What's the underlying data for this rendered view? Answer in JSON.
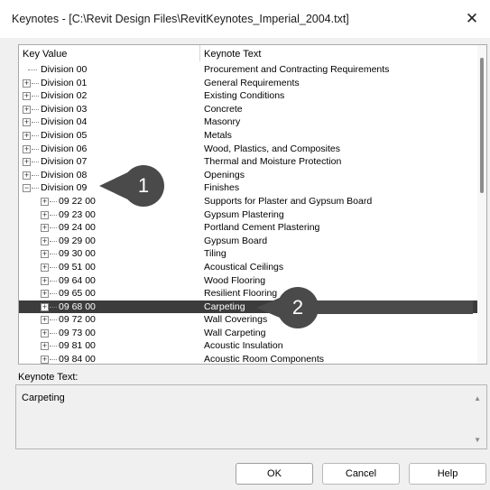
{
  "window": {
    "title": "Keynotes - [C:\\Revit Design Files\\RevitKeynotes_Imperial_2004.txt]"
  },
  "tree": {
    "columns": {
      "key": "Key Value",
      "text": "Keynote Text"
    },
    "rows": [
      {
        "key": "Division 00",
        "text": "Procurement and Contracting Requirements",
        "level": 0,
        "expander": "none"
      },
      {
        "key": "Division 01",
        "text": "General Requirements",
        "level": 0,
        "expander": "+"
      },
      {
        "key": "Division 02",
        "text": "Existing Conditions",
        "level": 0,
        "expander": "+"
      },
      {
        "key": "Division 03",
        "text": "Concrete",
        "level": 0,
        "expander": "+"
      },
      {
        "key": "Division 04",
        "text": "Masonry",
        "level": 0,
        "expander": "+"
      },
      {
        "key": "Division 05",
        "text": "Metals",
        "level": 0,
        "expander": "+"
      },
      {
        "key": "Division 06",
        "text": "Wood, Plastics, and Composites",
        "level": 0,
        "expander": "+"
      },
      {
        "key": "Division 07",
        "text": "Thermal and Moisture Protection",
        "level": 0,
        "expander": "+"
      },
      {
        "key": "Division 08",
        "text": "Openings",
        "level": 0,
        "expander": "+"
      },
      {
        "key": "Division 09",
        "text": "Finishes",
        "level": 0,
        "expander": "-"
      },
      {
        "key": "09 22 00",
        "text": "Supports for Plaster and Gypsum Board",
        "level": 1,
        "expander": "+"
      },
      {
        "key": "09 23 00",
        "text": "Gypsum Plastering",
        "level": 1,
        "expander": "+"
      },
      {
        "key": "09 24 00",
        "text": "Portland Cement Plastering",
        "level": 1,
        "expander": "+"
      },
      {
        "key": "09 29 00",
        "text": "Gypsum Board",
        "level": 1,
        "expander": "+"
      },
      {
        "key": "09 30 00",
        "text": "Tiling",
        "level": 1,
        "expander": "+"
      },
      {
        "key": "09 51 00",
        "text": "Acoustical Ceilings",
        "level": 1,
        "expander": "+"
      },
      {
        "key": "09 64 00",
        "text": "Wood Flooring",
        "level": 1,
        "expander": "+"
      },
      {
        "key": "09 65 00",
        "text": "Resilient Flooring",
        "level": 1,
        "expander": "+"
      },
      {
        "key": "09 68 00",
        "text": "Carpeting",
        "level": 1,
        "expander": "+",
        "selected": true
      },
      {
        "key": "09 72 00",
        "text": "Wall Coverings",
        "level": 1,
        "expander": "+"
      },
      {
        "key": "09 73 00",
        "text": "Wall Carpeting",
        "level": 1,
        "expander": "+"
      },
      {
        "key": "09 81 00",
        "text": "Acoustic Insulation",
        "level": 1,
        "expander": "+"
      },
      {
        "key": "09 84 00",
        "text": "Acoustic Room Components",
        "level": 1,
        "expander": "+"
      }
    ]
  },
  "callouts": [
    {
      "number": "1"
    },
    {
      "number": "2"
    }
  ],
  "keynote_panel": {
    "label": "Keynote Text:",
    "value": "Carpeting"
  },
  "buttons": {
    "ok": "OK",
    "cancel": "Cancel",
    "help": "Help"
  },
  "colors": {
    "selection": "#3c3c3c",
    "callout": "#4a4a4a"
  }
}
